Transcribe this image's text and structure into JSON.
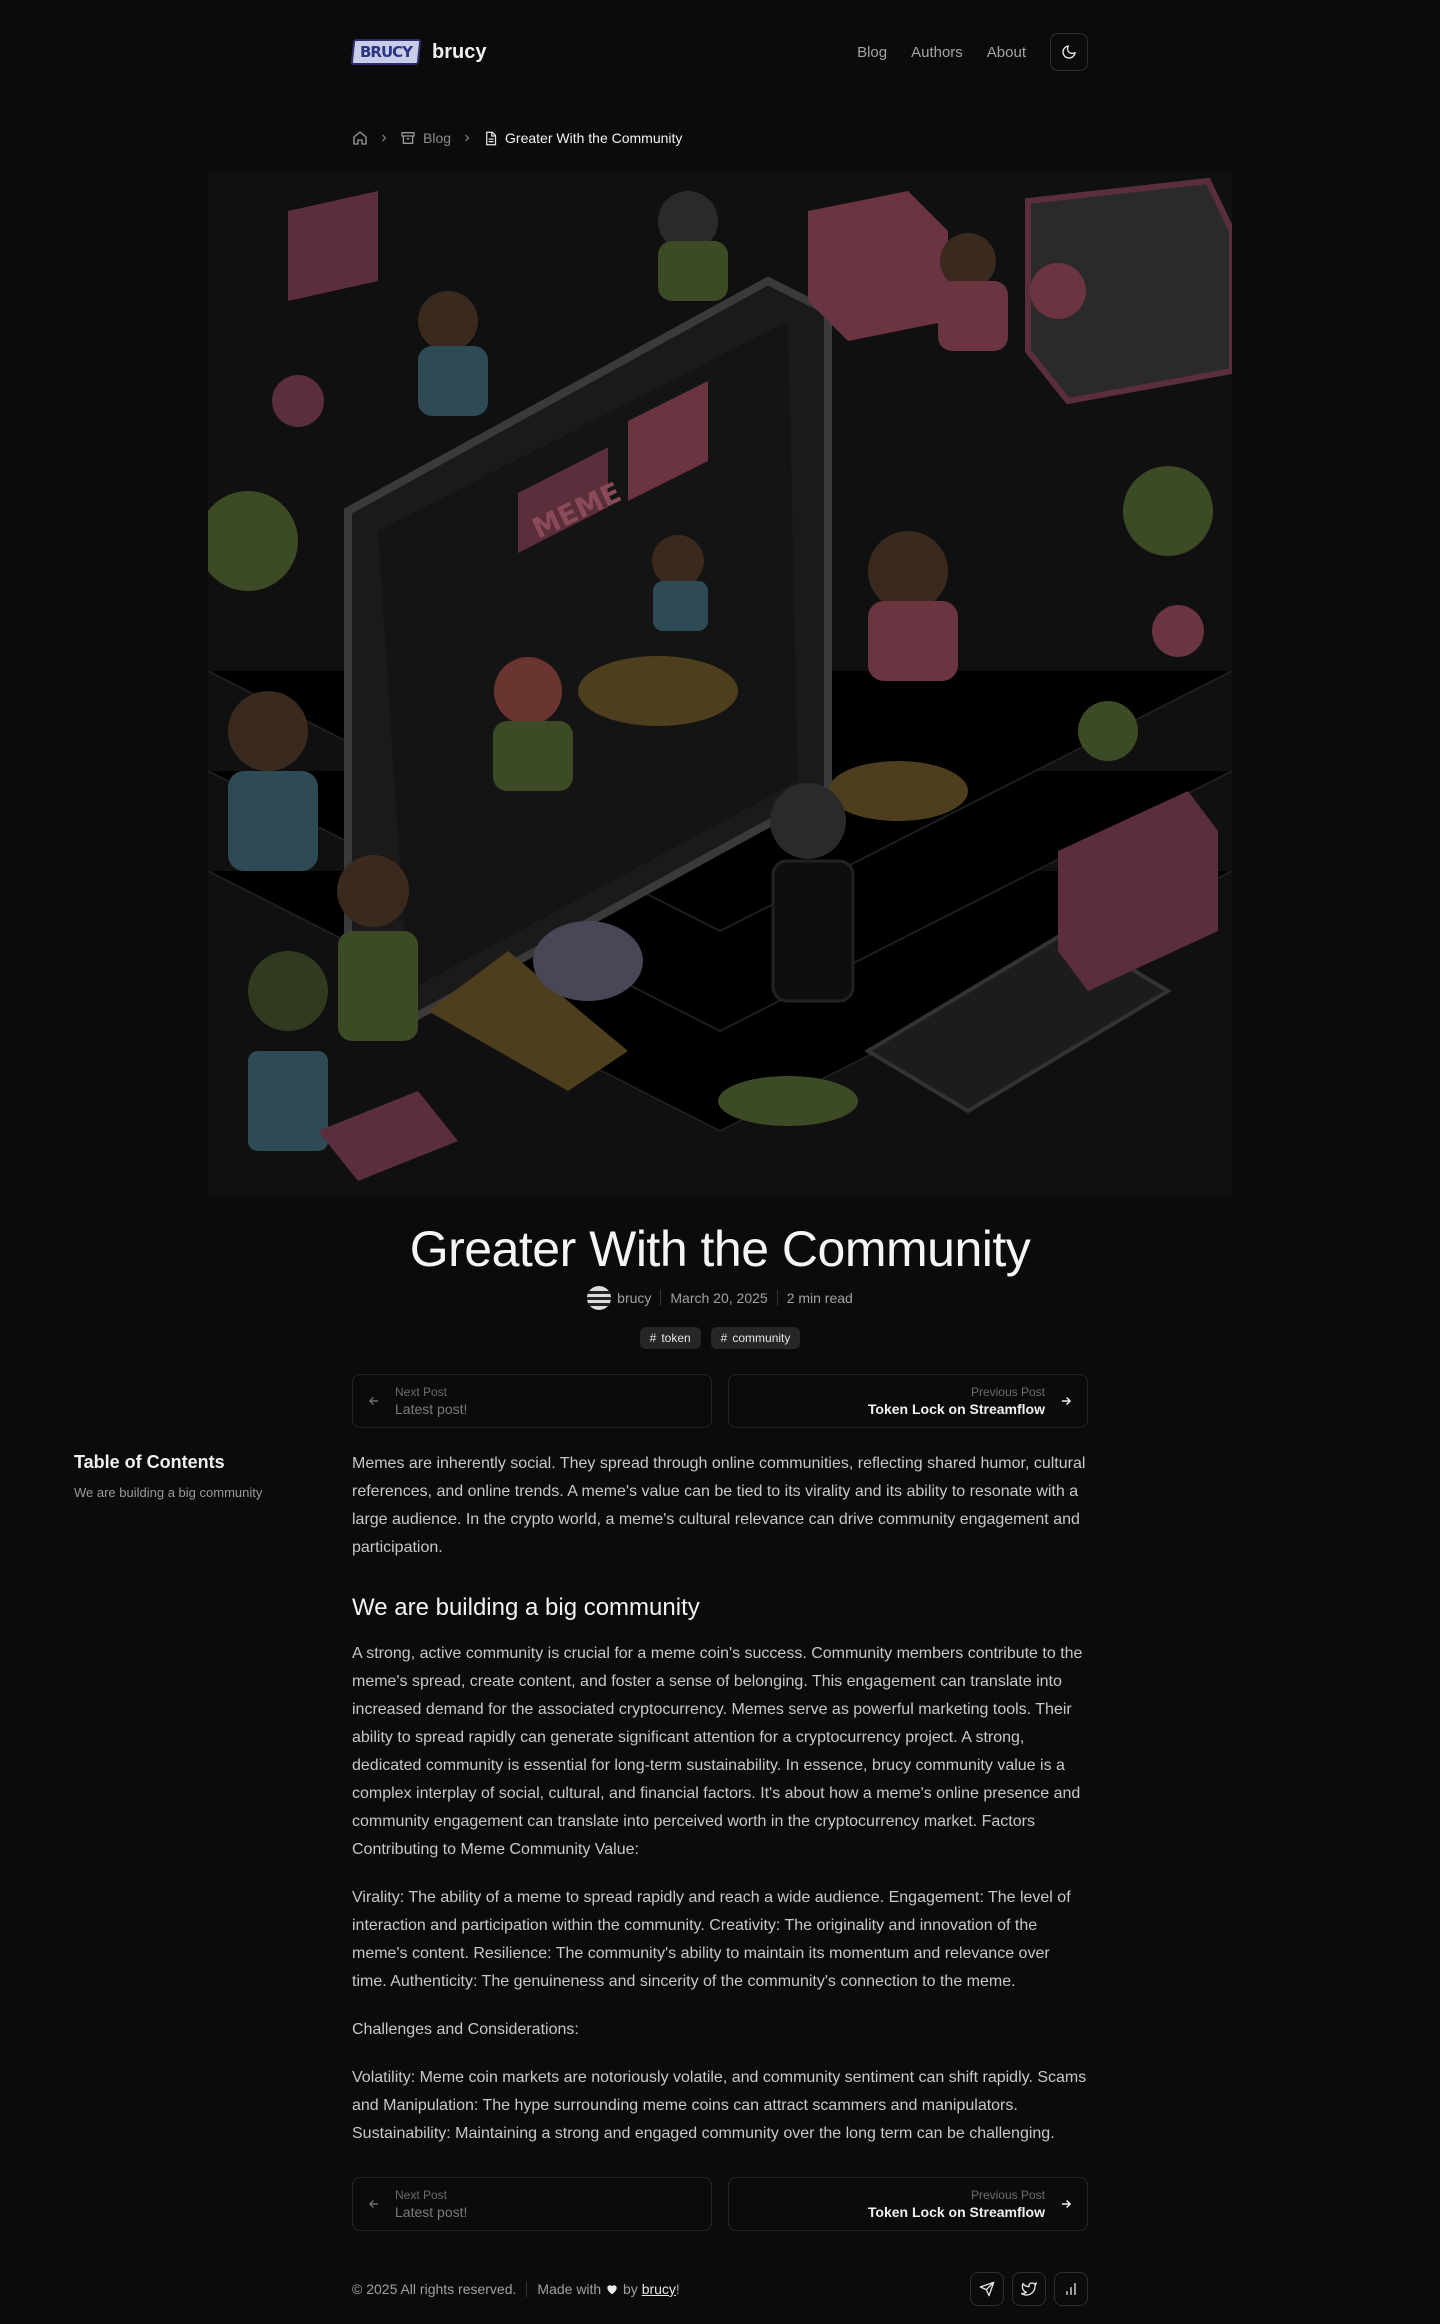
{
  "header": {
    "logo_text": "BRUCY",
    "brand": "brucy",
    "nav": [
      "Blog",
      "Authors",
      "About"
    ]
  },
  "breadcrumb": {
    "blog": "Blog",
    "current": "Greater With the Community"
  },
  "post": {
    "title": "Greater With the Community",
    "author": "brucy",
    "date": "March 20, 2025",
    "read_time": "2 min read",
    "tags": [
      "token",
      "community"
    ]
  },
  "post_nav": {
    "next_label": "Next Post",
    "next_title": "Latest post!",
    "prev_label": "Previous Post",
    "prev_title": "Token Lock on Streamflow"
  },
  "toc": {
    "title": "Table of Contents",
    "items": [
      "We are building a big community"
    ]
  },
  "article": {
    "intro": "Memes are inherently social. They spread through online communities, reflecting shared humor, cultural references, and online trends. A meme's value can be tied to its virality and its ability to resonate with a large audience. In the crypto world, a meme's cultural relevance can drive community engagement and participation.",
    "heading": "We are building a big community",
    "p1": "A strong, active community is crucial for a meme coin's success. Community members contribute to the meme's spread, create content, and foster a sense of belonging. This engagement can translate into increased demand for the associated cryptocurrency. Memes serve as powerful marketing tools. Their ability to spread rapidly can generate significant attention for a cryptocurrency project. A strong, dedicated community is essential for long-term sustainability. In essence, brucy community value is a complex interplay of social, cultural, and financial factors. It's about how a meme's online presence and community engagement can translate into perceived worth in the cryptocurrency market. Factors Contributing to Meme Community Value:",
    "p2": "Virality: The ability of a meme to spread rapidly and reach a wide audience. Engagement: The level of interaction and participation within the community. Creativity: The originality and innovation of the meme's content. Resilience: The community's ability to maintain its momentum and relevance over time. Authenticity: The genuineness and sincerity of the community's connection to the meme.",
    "p3": "Challenges and Considerations:",
    "p4": "Volatility: Meme coin markets are notoriously volatile, and community sentiment can shift rapidly.   Scams and Manipulation: The hype surrounding meme coins can attract scammers and manipulators. Sustainability: Maintaining a strong and engaged community over the long term can be challenging."
  },
  "footer": {
    "copyright": "© 2025 All rights reserved.",
    "made_with": "Made with",
    "by": "by",
    "author_link": "brucy",
    "exclaim": "!"
  },
  "hero_image": {
    "sign_text": "MEME"
  },
  "colors": {
    "background": "#0b0b0b",
    "text": "#d4d4d4",
    "heading": "#f5f5f5"
  }
}
